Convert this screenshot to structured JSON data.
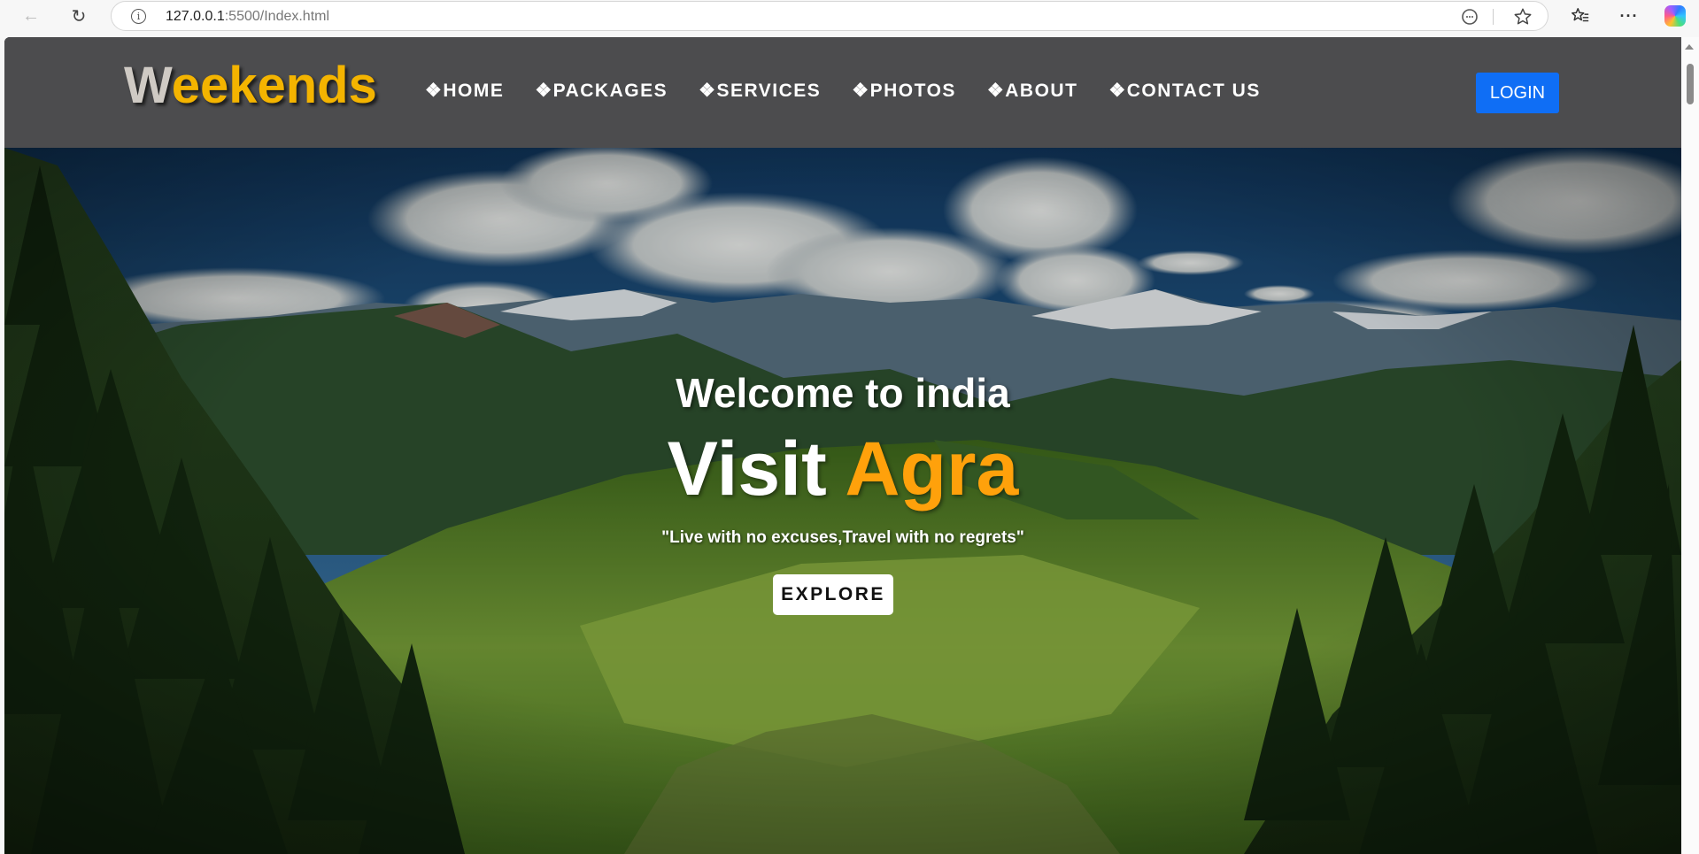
{
  "browser": {
    "url_host": "127.0.0.1",
    "url_rest": ":5500/Index.html",
    "icons": [
      "back-arrow-icon",
      "reload-icon",
      "info-icon",
      "reader-icon",
      "star-icon",
      "favorites-icon",
      "more-icon",
      "copilot-icon"
    ]
  },
  "site": {
    "logo_first": "W",
    "logo_rest": "eekends",
    "nav": [
      {
        "label": "❖HOME"
      },
      {
        "label": "❖PACKAGES"
      },
      {
        "label": "❖SERVICES"
      },
      {
        "label": "❖PHOTOS"
      },
      {
        "label": "❖ABOUT"
      },
      {
        "label": "❖CONTACT US"
      }
    ],
    "login_label": "LOGIN",
    "colors": {
      "navbar": "#4c4c4e",
      "logo_accent": "#f4b400",
      "login_button": "#0f6ef5",
      "title_accent": "#ffa10b"
    }
  },
  "hero": {
    "welcome": "Welcome to india",
    "title_white": "Visit ",
    "title_accent": "Agra",
    "quote": "\"Live with no excuses,Travel with no regrets\"",
    "explore_label": "EXPLORE"
  }
}
